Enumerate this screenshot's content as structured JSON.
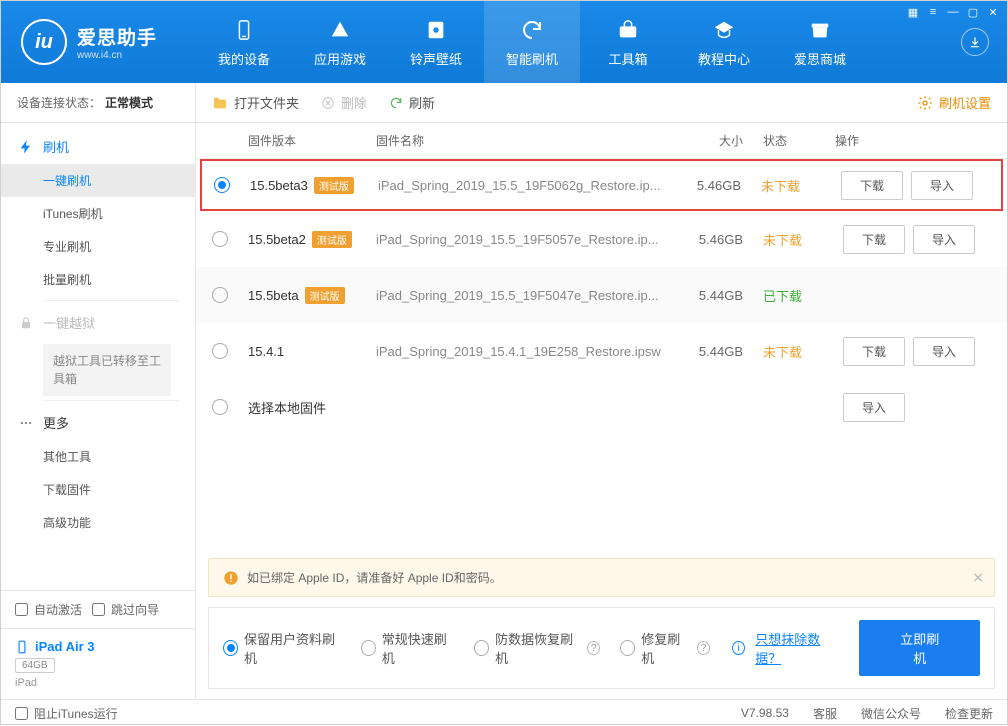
{
  "brand": {
    "name": "爱思助手",
    "sub": "www.i4.cn",
    "logo": "iu"
  },
  "nav": {
    "items": [
      {
        "label": "我的设备"
      },
      {
        "label": "应用游戏"
      },
      {
        "label": "铃声壁纸"
      },
      {
        "label": "智能刷机"
      },
      {
        "label": "工具箱"
      },
      {
        "label": "教程中心"
      },
      {
        "label": "爱思商城"
      }
    ]
  },
  "sidebar": {
    "status_label": "设备连接状态：",
    "status_value": "正常模式",
    "flash_head": "刷机",
    "flash_items": [
      "一键刷机",
      "iTunes刷机",
      "专业刷机",
      "批量刷机"
    ],
    "jailbreak_head": "一键越狱",
    "jailbreak_note": "越狱工具已转移至工具箱",
    "more_head": "更多",
    "more_items": [
      "其他工具",
      "下载固件",
      "高级功能"
    ],
    "auto_activate": "自动激活",
    "skip_guide": "跳过向导",
    "device_name": "iPad Air 3",
    "device_cap": "64GB",
    "device_sub": "iPad"
  },
  "toolbar": {
    "open": "打开文件夹",
    "delete": "删除",
    "refresh": "刷新",
    "settings": "刷机设置"
  },
  "table": {
    "cols": {
      "ver": "固件版本",
      "name": "固件名称",
      "size": "大小",
      "status": "状态",
      "actions": "操作"
    },
    "rows": [
      {
        "ver": "15.5beta3",
        "beta": "测试版",
        "name": "iPad_Spring_2019_15.5_19F5062g_Restore.ip...",
        "size": "5.46GB",
        "status": "未下载",
        "status_class": "orange",
        "checked": true,
        "download": "下载",
        "import": "导入"
      },
      {
        "ver": "15.5beta2",
        "beta": "测试版",
        "name": "iPad_Spring_2019_15.5_19F5057e_Restore.ip...",
        "size": "5.46GB",
        "status": "未下载",
        "status_class": "orange",
        "checked": false,
        "download": "下载",
        "import": "导入"
      },
      {
        "ver": "15.5beta",
        "beta": "测试版",
        "name": "iPad_Spring_2019_15.5_19F5047e_Restore.ip...",
        "size": "5.44GB",
        "status": "已下载",
        "status_class": "green",
        "checked": false
      },
      {
        "ver": "15.4.1",
        "beta": "",
        "name": "iPad_Spring_2019_15.4.1_19E258_Restore.ipsw",
        "size": "5.44GB",
        "status": "未下载",
        "status_class": "orange",
        "checked": false,
        "download": "下载",
        "import": "导入"
      }
    ],
    "local_ver": "选择本地固件",
    "local_import": "导入"
  },
  "warn": "如已绑定 Apple ID，请准备好 Apple ID和密码。",
  "flash": {
    "opts": [
      "保留用户资料刷机",
      "常规快速刷机",
      "防数据恢复刷机",
      "修复刷机"
    ],
    "link": "只想抹除数据？",
    "btn": "立即刷机"
  },
  "status": {
    "block_itunes": "阻止iTunes运行",
    "version": "V7.98.53",
    "kefu": "客服",
    "wechat": "微信公众号",
    "update": "检查更新"
  }
}
